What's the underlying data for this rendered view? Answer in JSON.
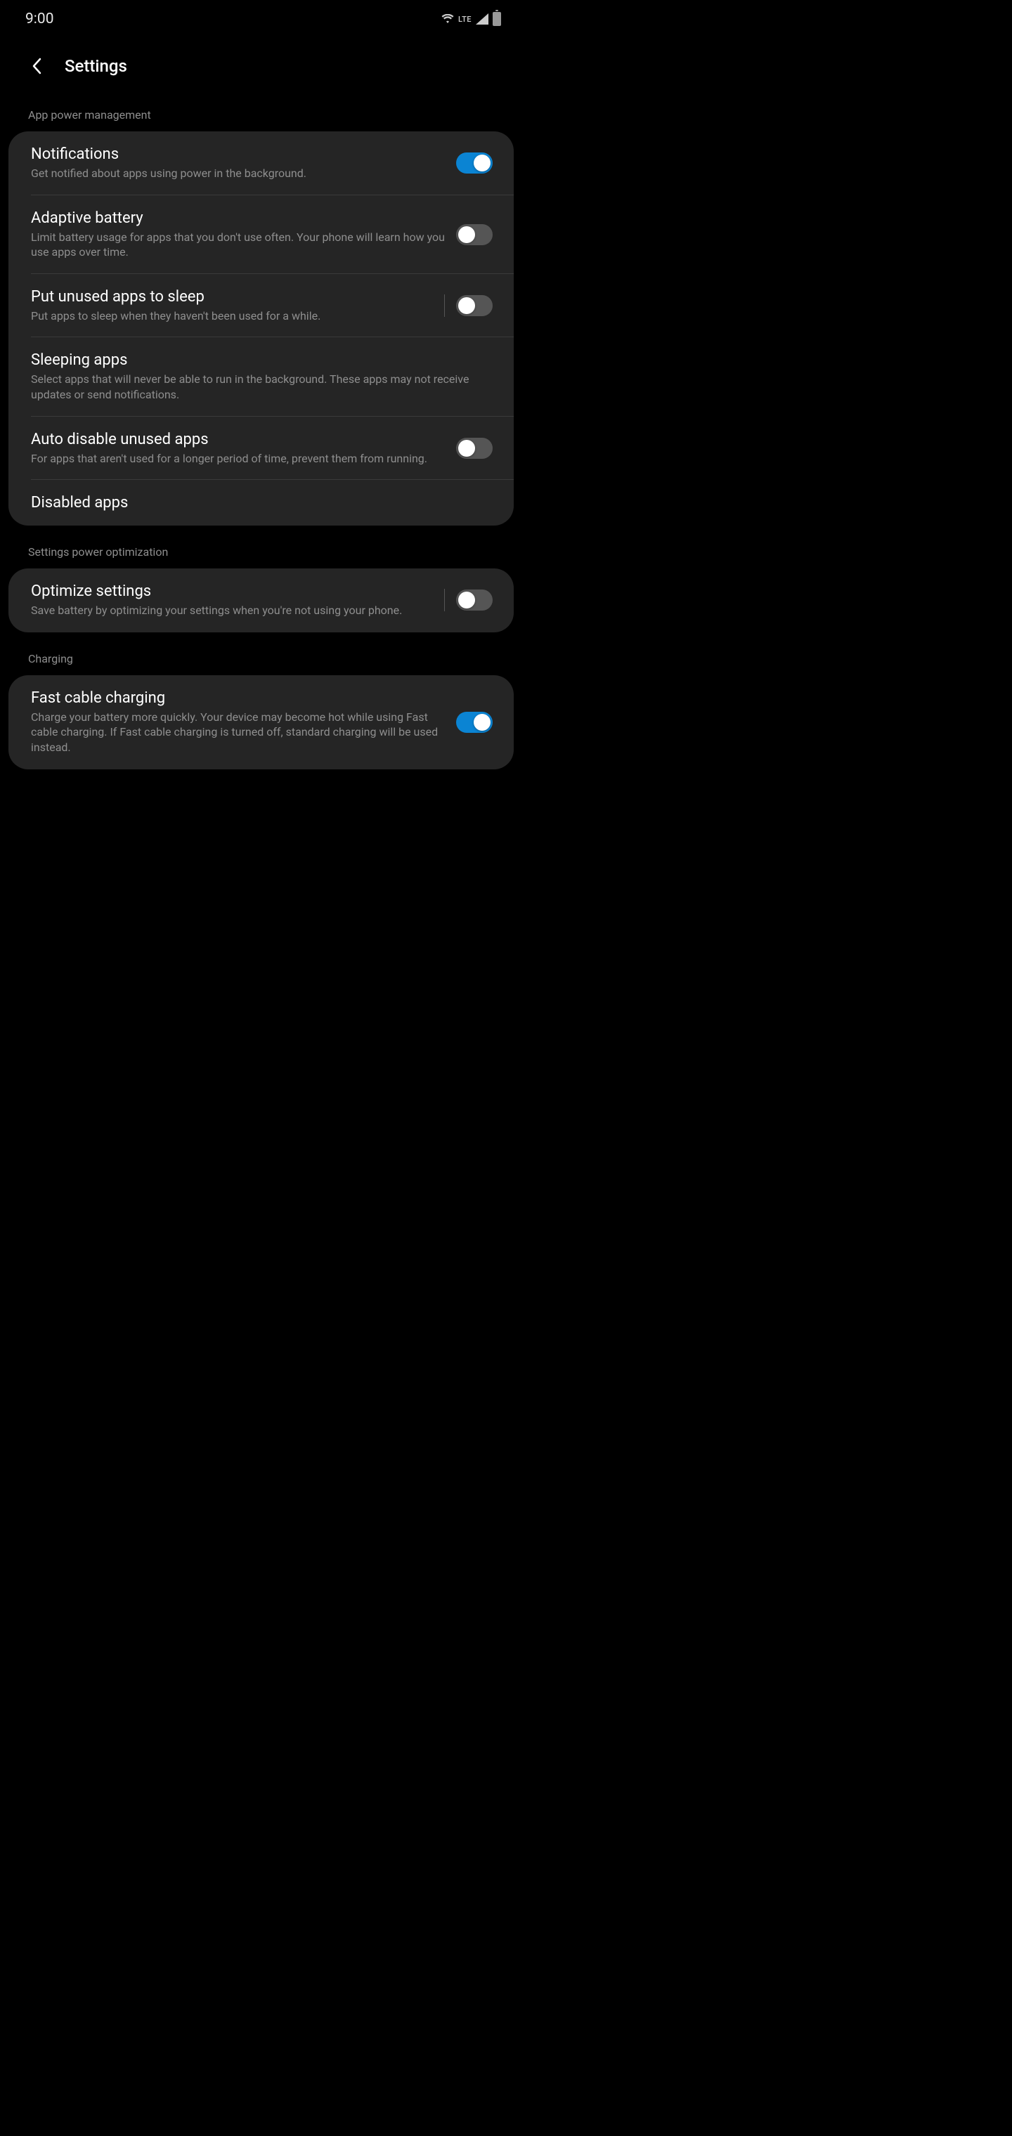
{
  "status": {
    "time": "9:00",
    "lte": "LTE"
  },
  "header": {
    "title": "Settings"
  },
  "sections": {
    "s0": {
      "header": "App power management",
      "rows": {
        "r0": {
          "title": "Notifications",
          "desc": "Get notified about apps using power in the background."
        },
        "r1": {
          "title": "Adaptive battery",
          "desc": "Limit battery usage for apps that you don't use often. Your phone will learn how you use apps over time."
        },
        "r2": {
          "title": "Put unused apps to sleep",
          "desc": "Put apps to sleep when they haven't been used for a while."
        },
        "r3": {
          "title": "Sleeping apps",
          "desc": "Select apps that will never be able to run in the background. These apps may not receive updates or send notifications."
        },
        "r4": {
          "title": "Auto disable unused apps",
          "desc": "For apps that aren't used for a longer period of time, prevent them from running."
        },
        "r5": {
          "title": "Disabled apps"
        }
      }
    },
    "s1": {
      "header": "Settings power optimization",
      "rows": {
        "r0": {
          "title": "Optimize settings",
          "desc": "Save battery by optimizing your settings when you're not using your phone."
        }
      }
    },
    "s2": {
      "header": "Charging",
      "rows": {
        "r0": {
          "title": "Fast cable charging",
          "desc": "Charge your battery more quickly. Your device may become hot while using Fast cable charging. If Fast cable charging is turned off, standard charging will be used instead."
        }
      }
    }
  }
}
